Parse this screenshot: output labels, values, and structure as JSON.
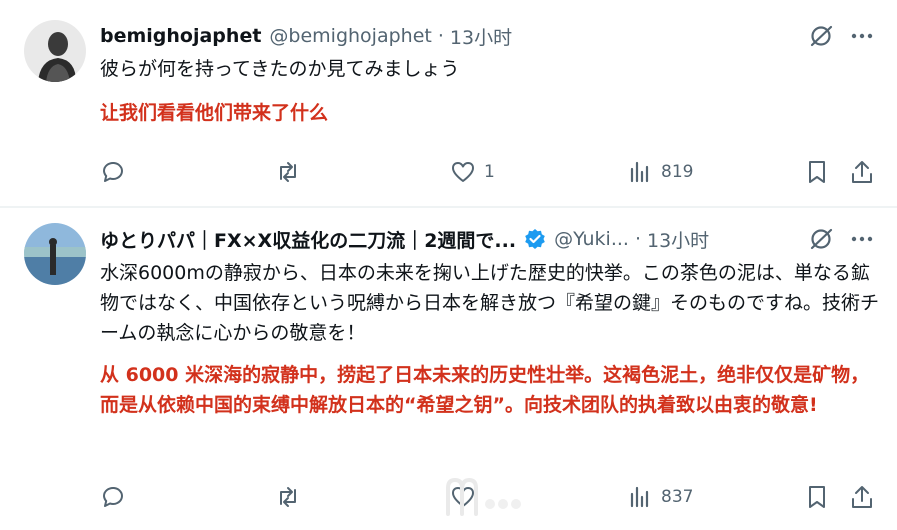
{
  "post1": {
    "display_name": "bemighojaphet",
    "handle": "@bemighojaphet",
    "separator": "·",
    "time": "13小时",
    "text_original": "彼らが何を持ってきたのか見てみましょう",
    "text_translation": "让我们看看他们带来了什么",
    "replies": "",
    "reposts": "",
    "likes": "1",
    "views": "819"
  },
  "post2": {
    "display_name": "ゆとりパパ｜FX×X収益化の二刀流｜2週間で...",
    "handle": "@Yuki...",
    "separator": "·",
    "time": "13小时",
    "text_original": "水深6000mの静寂から、日本の未来を掬い上げた歴史的快挙。この茶色の泥は、単なる鉱物ではなく、中国依存という呪縛から日本を解き放つ『希望の鍵』そのものですね。技術チームの執念に心からの敬意を！",
    "text_translation": "从 6000 米深海的寂静中，捞起了日本未来的历史性壮举。这褐色泥土，绝非仅仅是矿物，而是从依赖中国的束缚中解放日本的“希望之钥”。向技术团队的执着致以由衷的敬意!",
    "replies": "",
    "reposts": "",
    "likes": "",
    "views": "837"
  },
  "colors": {
    "translation_red": "#d2311c",
    "secondary_gray": "#536471",
    "verified_blue": "#1d9bf0",
    "divider": "#eff3f4"
  },
  "icons": [
    "reply-icon",
    "repost-icon",
    "like-icon",
    "views-icon",
    "bookmark-icon",
    "share-icon",
    "grok-icon",
    "more-icon",
    "verified-badge-icon"
  ]
}
